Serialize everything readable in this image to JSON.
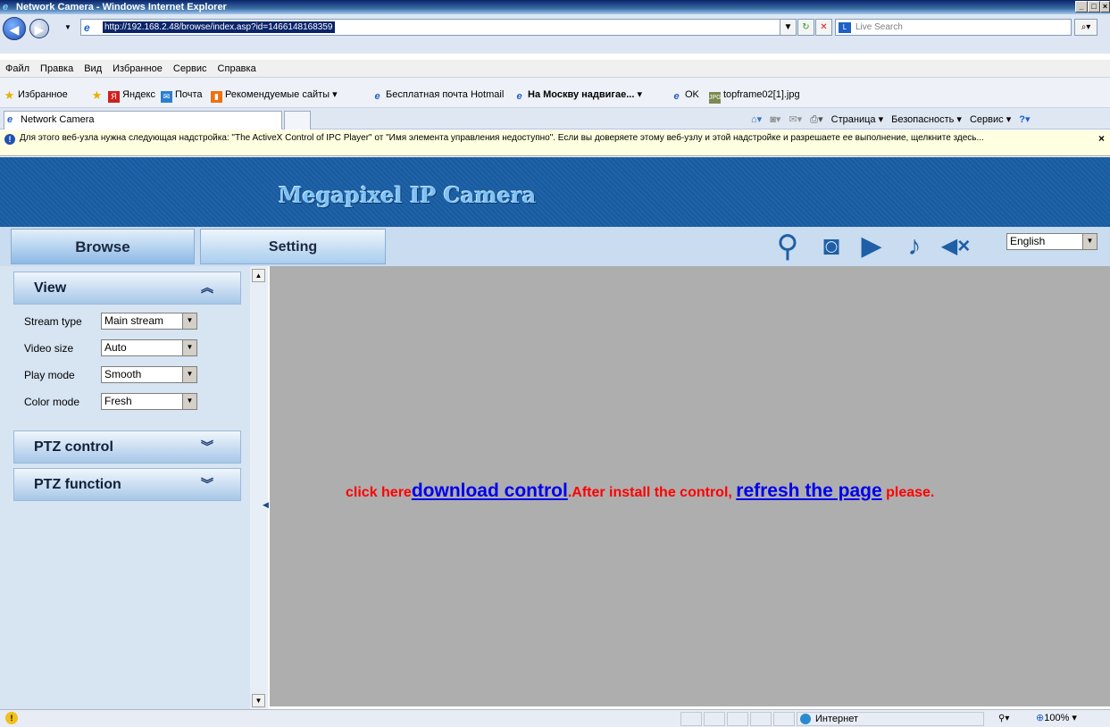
{
  "window": {
    "title": "Network Camera - Windows Internet Explorer"
  },
  "address": {
    "url": "http://192.168.2.48/browse/index.asp?id=1466148168359",
    "search_placeholder": "Live Search"
  },
  "menu": [
    "Файл",
    "Правка",
    "Вид",
    "Избранное",
    "Сервис",
    "Справка"
  ],
  "favorites": {
    "label": "Избранное",
    "items": [
      "Яндекс",
      "Почта",
      "Рекомендуемые сайты ▾",
      "Бесплатная почта Hotmail",
      "На Москву надвигае... ▾",
      "OK",
      "topframe02[1].jpg"
    ]
  },
  "tabs": {
    "active": "Network Camera"
  },
  "commandbar": {
    "page": "Страница ▾",
    "security": "Безопасность ▾",
    "tools": "Сервис ▾"
  },
  "infobar": {
    "text": "Для этого веб-узла нужна следующая надстройка: \"The ActiveX Control of IPC Player\" от \"Имя элемента управления недоступно\". Если вы доверяете этому веб-узлу и этой надстройке и разрешаете ее выполнение, щелкните здесь..."
  },
  "camera": {
    "title": "Megapixel IP Camera",
    "nav": {
      "browse": "Browse",
      "setting": "Setting"
    },
    "language": "English"
  },
  "sidebar": {
    "view": {
      "title": "View",
      "fields": [
        {
          "label": "Stream type",
          "value": "Main stream"
        },
        {
          "label": "Video size",
          "value": "Auto"
        },
        {
          "label": "Play mode",
          "value": "Smooth"
        },
        {
          "label": "Color mode",
          "value": "Fresh"
        }
      ]
    },
    "ptz_control": {
      "title": "PTZ control"
    },
    "ptz_function": {
      "title": "PTZ function"
    }
  },
  "main": {
    "msg_prefix": "click here",
    "msg_link1": "download control",
    "msg_middle": ".After install the control, ",
    "msg_link2": "refresh the page",
    "msg_suffix": " please."
  },
  "status": {
    "zone": "Интернет",
    "zoom": "100%"
  }
}
